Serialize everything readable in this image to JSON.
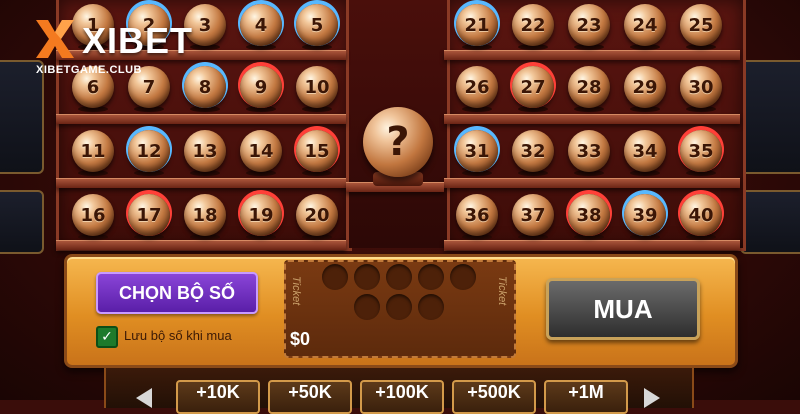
{
  "brand": {
    "name": "XIBET",
    "site": "XIBETGAME.CLUB",
    "accent": "#f47a1f"
  },
  "balls": [
    {
      "n": "1",
      "glow": "none"
    },
    {
      "n": "2",
      "glow": "blue"
    },
    {
      "n": "3",
      "glow": "none"
    },
    {
      "n": "4",
      "glow": "blue"
    },
    {
      "n": "5",
      "glow": "blue"
    },
    {
      "n": "6",
      "glow": "none"
    },
    {
      "n": "7",
      "glow": "none"
    },
    {
      "n": "8",
      "glow": "blue"
    },
    {
      "n": "9",
      "glow": "red"
    },
    {
      "n": "10",
      "glow": "none"
    },
    {
      "n": "11",
      "glow": "none"
    },
    {
      "n": "12",
      "glow": "blue"
    },
    {
      "n": "13",
      "glow": "none"
    },
    {
      "n": "14",
      "glow": "none"
    },
    {
      "n": "15",
      "glow": "red"
    },
    {
      "n": "16",
      "glow": "none"
    },
    {
      "n": "17",
      "glow": "red"
    },
    {
      "n": "18",
      "glow": "none"
    },
    {
      "n": "19",
      "glow": "red"
    },
    {
      "n": "20",
      "glow": "none"
    },
    {
      "n": "21",
      "glow": "blue"
    },
    {
      "n": "22",
      "glow": "none"
    },
    {
      "n": "23",
      "glow": "none"
    },
    {
      "n": "24",
      "glow": "none"
    },
    {
      "n": "25",
      "glow": "none"
    },
    {
      "n": "26",
      "glow": "none"
    },
    {
      "n": "27",
      "glow": "red"
    },
    {
      "n": "28",
      "glow": "none"
    },
    {
      "n": "29",
      "glow": "none"
    },
    {
      "n": "30",
      "glow": "none"
    },
    {
      "n": "31",
      "glow": "blue"
    },
    {
      "n": "32",
      "glow": "none"
    },
    {
      "n": "33",
      "glow": "none"
    },
    {
      "n": "34",
      "glow": "none"
    },
    {
      "n": "35",
      "glow": "red"
    },
    {
      "n": "36",
      "glow": "none"
    },
    {
      "n": "37",
      "glow": "none"
    },
    {
      "n": "38",
      "glow": "red"
    },
    {
      "n": "39",
      "glow": "blue"
    },
    {
      "n": "40",
      "glow": "red"
    }
  ],
  "mystery_ball": "?",
  "controls": {
    "choose_label": "CHỌN BỘ SỐ",
    "save_label": "Lưu bộ số khi mua",
    "save_checked": true,
    "ticket_label": "Ticket",
    "ticket_amount": "$0",
    "buy_label": "MUA"
  },
  "bets": [
    "+10K",
    "+50K",
    "+100K",
    "+500K",
    "+1M"
  ]
}
